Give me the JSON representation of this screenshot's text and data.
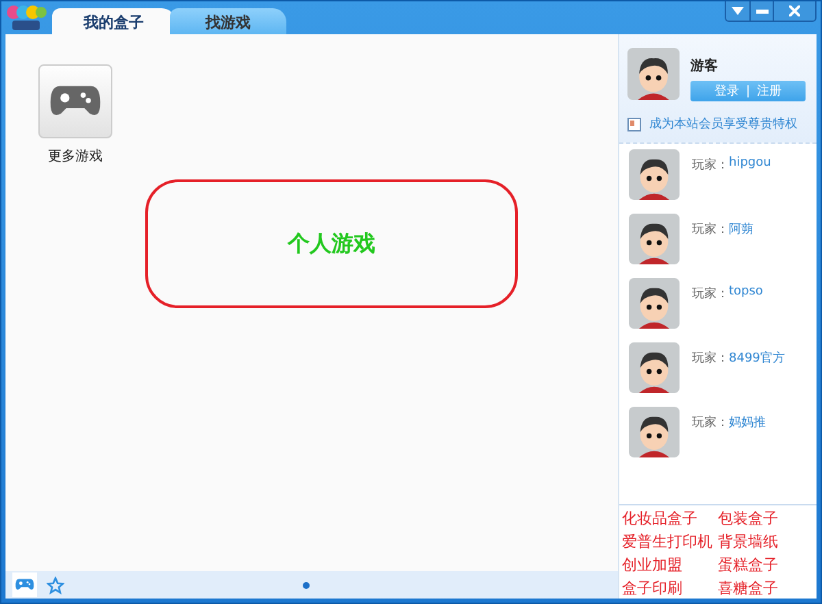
{
  "tabs": [
    {
      "label": "我的盒子",
      "selected": true
    },
    {
      "label": "找游戏",
      "selected": false
    }
  ],
  "games": [
    {
      "label": "更多游戏"
    }
  ],
  "banner": {
    "text": "个人游戏"
  },
  "user": {
    "name": "游客",
    "login": "登录",
    "separator": "|",
    "register": "注册",
    "promo": "成为本站会员享受尊贵特权"
  },
  "players": [
    {
      "prefix": "玩家：",
      "name": "hipgou"
    },
    {
      "prefix": "玩家：",
      "name": "阿蒴"
    },
    {
      "prefix": "玩家：",
      "name": "topso"
    },
    {
      "prefix": "玩家：",
      "name": "8499官方"
    },
    {
      "prefix": "玩家：",
      "name": "妈妈推"
    }
  ],
  "links": [
    "化妆品盒子",
    "包装盒子",
    "爱普生打印机",
    "背景墙纸",
    "创业加盟",
    "蛋糕盒子",
    "盒子印刷",
    "喜糖盒子"
  ],
  "bottom_tabs": [
    {
      "kind": "games",
      "selected": true
    },
    {
      "kind": "favorites",
      "selected": false
    }
  ]
}
